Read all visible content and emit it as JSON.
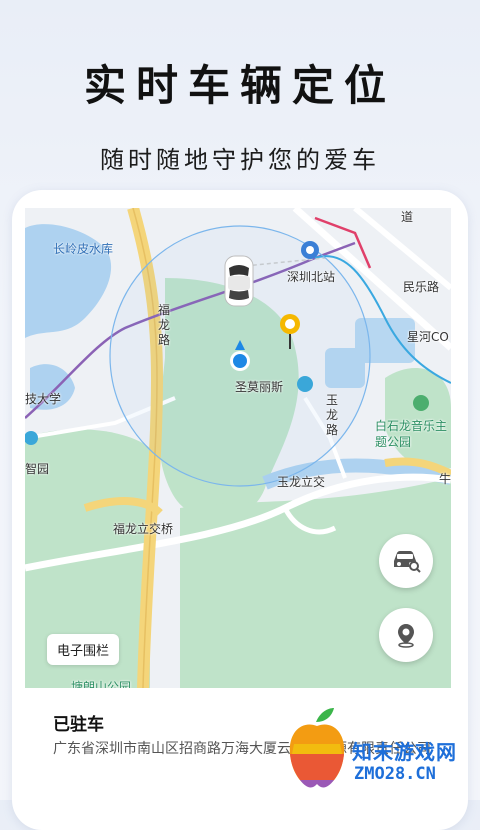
{
  "header": {
    "title": "实时车辆定位",
    "subtitle": "随时随地守护您的爱车"
  },
  "map": {
    "labels": {
      "changling": "长岭皮水库",
      "shenzhen_north": "深圳北站",
      "fulong_road": "福龙路",
      "simone": "圣莫丽斯",
      "yulong_road": "玉龙路",
      "yulong_interchange": "玉龙立交",
      "fulong_interchange": "福龙立交桥",
      "university": "技大学",
      "zhiyuan": "智园",
      "baishilong": "白石龙音乐主题公园",
      "minle_road": "民乐路",
      "xinghe": "星河CO",
      "niu": "牛",
      "dao": "道",
      "park_bottom": "塘朗山公园"
    },
    "fence_label": "电子围栏"
  },
  "controls": {
    "find_car_icon": "car-search-icon",
    "location_icon": "location-pin-icon"
  },
  "info": {
    "status": "已驻车",
    "address": "广东省深圳市南山区招商路万海大厦云度新能源有限责任公司"
  },
  "watermark": {
    "text": "知末游戏网",
    "url": "ZMO28.CN"
  },
  "colors": {
    "accent_blue": "#1e88e5",
    "pin_yellow": "#f5b800",
    "park_green": "#bfe3c9",
    "road_yellow": "#f4d57a",
    "metro_purple": "#8b62b5"
  }
}
